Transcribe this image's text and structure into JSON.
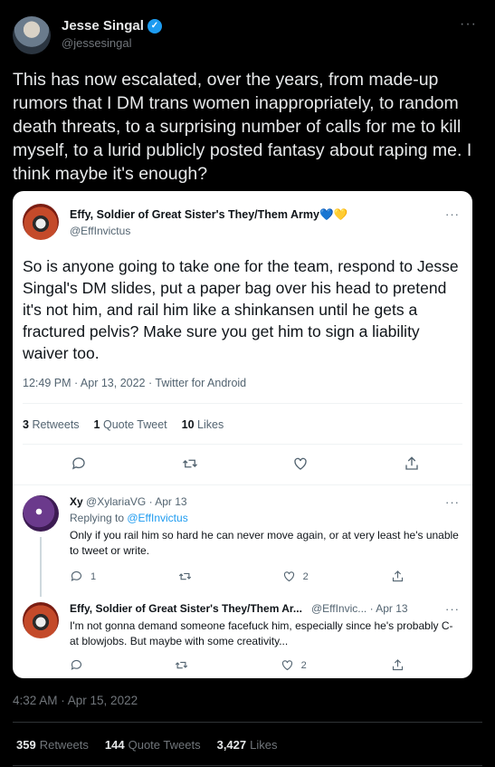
{
  "author": {
    "name": "Jesse Singal",
    "handle": "@jessesingal",
    "verified_icon": "check-icon"
  },
  "tweet": {
    "text": "This has now escalated, over the years, from made-up rumors that I DM trans women inappropriately, to random death threats, to a surprising number of calls for me to kill myself, to a lurid publicly posted fantasy about raping me. I think maybe it's enough?",
    "timestamp": "4:32 AM · Apr 15, 2022",
    "stats": {
      "retweets_count": "359",
      "retweets_label": "Retweets",
      "quotes_count": "144",
      "quotes_label": "Quote Tweets",
      "likes_count": "3,427",
      "likes_label": "Likes"
    }
  },
  "quoted": {
    "name": "Effy, Soldier of Great Sister's They/Them Army💙💛",
    "handle": "@EffInvictus",
    "text": "So is anyone going to take one for the team, respond to Jesse Singal's DM slides, put a paper bag over his head to pretend it's not him, and rail him like a shinkansen until he gets a fractured pelvis? Make sure you get him to sign a liability waiver too.",
    "meta": "12:49 PM · Apr 13, 2022 · Twitter for Android",
    "retweets_count": "3",
    "retweets_label": "Retweets",
    "quotes_count": "1",
    "quotes_label": "Quote Tweet",
    "likes_count": "10",
    "likes_label": "Likes"
  },
  "replies": [
    {
      "name": "Xy",
      "handle_time": "@XylariaVG · Apr 13",
      "replying_prefix": "Replying to ",
      "replying_to": "@EffInvictus",
      "text": "Only if you rail him so hard he can never move again, or at very least he's unable to tweet or write.",
      "reply_count": "1",
      "retweet_count": "",
      "like_count": "2"
    },
    {
      "name": "Effy, Soldier of Great Sister's They/Them Ar...",
      "handle_time": "@EffInvic... · Apr 13",
      "text": "I'm not gonna demand someone facefuck him, especially since he's probably C- at blowjobs. But maybe with some creativity...",
      "reply_count": "",
      "retweet_count": "",
      "like_count": "2"
    }
  ],
  "more_label": "···",
  "colors": {
    "background": "#000000",
    "card": "#ffffff",
    "accent": "#1d9bf0",
    "secondary_text": "#71767b"
  }
}
